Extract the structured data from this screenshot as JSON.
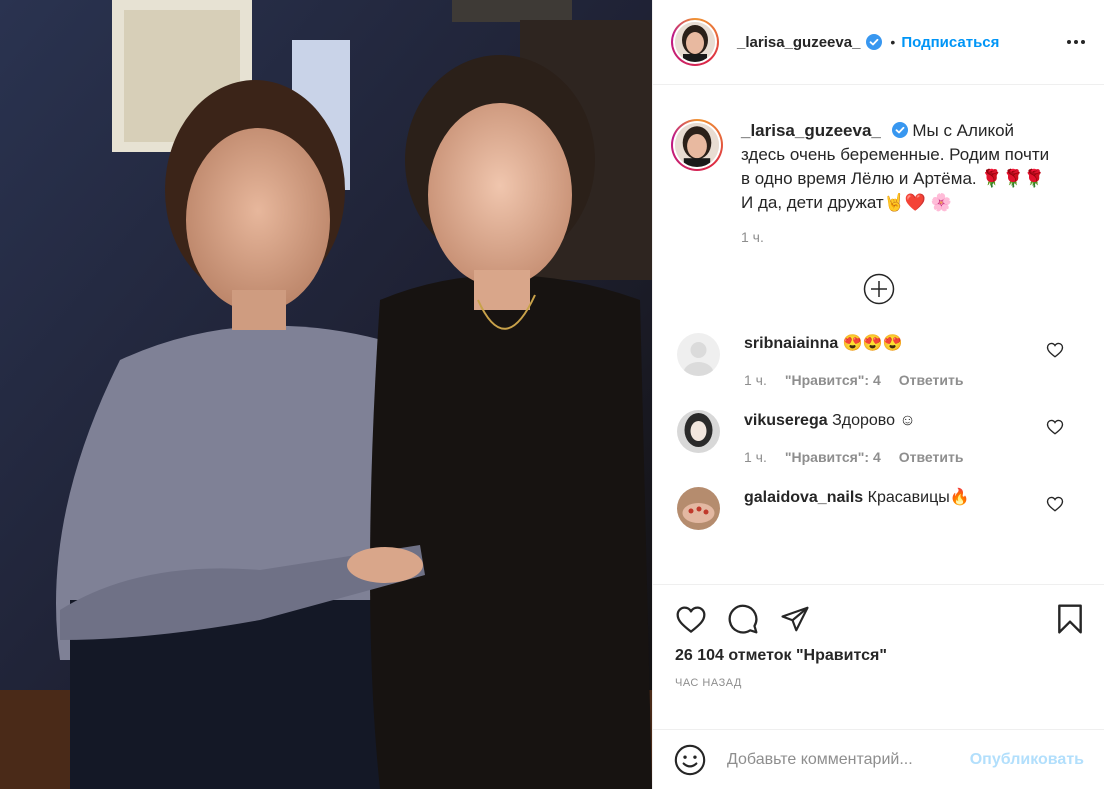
{
  "header": {
    "username": "_larisa_guzeeva_",
    "dot": "•",
    "follow_label": "Подписаться"
  },
  "caption": {
    "username": "_larisa_guzeeva_",
    "text": "Мы с Аликой здесь очень беременные. Родим почти в одно время Лёлю и Артёма. 🌹🌹🌹 И да, дети дружат🤘❤️ 🌸",
    "time": "1 ч."
  },
  "comments": [
    {
      "user": "sribnaiainna",
      "text": "😍😍😍",
      "time": "1 ч.",
      "likes": "\"Нравится\": 4",
      "reply": "Ответить"
    },
    {
      "user": "vikuserega",
      "text": "Здорово ☺",
      "time": "1 ч.",
      "likes": "\"Нравится\": 4",
      "reply": "Ответить"
    },
    {
      "user": "galaidova_nails",
      "text": "Красавицы🔥"
    }
  ],
  "actions": {
    "likes_text": "26 104 отметок \"Нравится\"",
    "time_ago": "час назад"
  },
  "add_comment": {
    "placeholder": "Добавьте комментарий...",
    "publish_label": "Опубликовать"
  },
  "colors": {
    "accent": "#0095f6",
    "publish_disabled": "#b2dffc",
    "muted": "#8e8e8e"
  }
}
